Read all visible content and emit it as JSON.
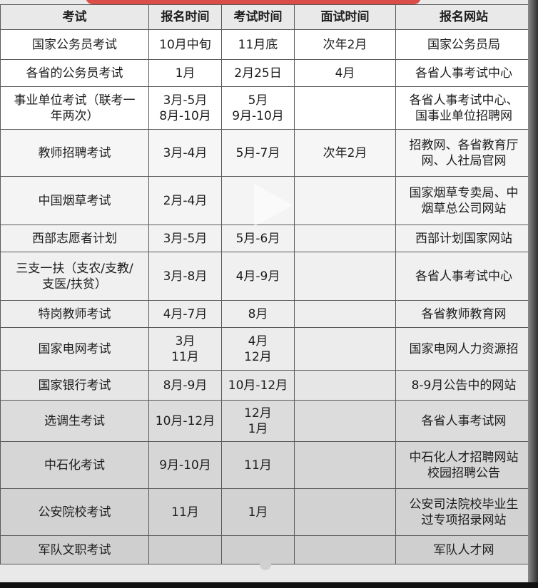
{
  "table": {
    "headers": [
      "考试",
      "报名时间",
      "考试时间",
      "面试时间",
      "报名网站"
    ],
    "rows": [
      {
        "name": [
          "国家公务员考试"
        ],
        "reg": [
          "10月中旬"
        ],
        "exam": [
          "11月底"
        ],
        "interview": [
          "次年2月"
        ],
        "site": [
          "国家公务员局"
        ]
      },
      {
        "name": [
          "各省的公务员考试"
        ],
        "reg": [
          "1月"
        ],
        "exam": [
          "2月25日"
        ],
        "interview": [
          "4月"
        ],
        "site": [
          "各省人事考试中心"
        ]
      },
      {
        "name": [
          "事业单位考试（联考一",
          "年两次）"
        ],
        "reg": [
          "3月-5月",
          "8月-10月"
        ],
        "exam": [
          "5月",
          "9月-10月"
        ],
        "interview": [],
        "site": [
          "各省人事考试中心、",
          "国事业单位招聘网"
        ]
      },
      {
        "name": [
          "教师招聘考试"
        ],
        "reg": [
          "3月-4月"
        ],
        "exam": [
          "5月-7月"
        ],
        "interview": [
          "次年2月"
        ],
        "site": [
          "招教网、各省教育厅",
          "网、人社局官网"
        ]
      },
      {
        "name": [
          "中国烟草考试"
        ],
        "reg": [
          "2月-4月"
        ],
        "exam": [],
        "interview": [],
        "site": [
          "国家烟草专卖局、中",
          "烟草总公司网站"
        ]
      },
      {
        "name": [
          "西部志愿者计划"
        ],
        "reg": [
          "3月-5月"
        ],
        "exam": [
          "5月-6月"
        ],
        "interview": [],
        "site": [
          "西部计划国家网站"
        ]
      },
      {
        "name": [
          "三支一扶（支农/支教/",
          "支医/扶贫）"
        ],
        "reg": [
          "3月-8月"
        ],
        "exam": [
          "4月-9月"
        ],
        "interview": [],
        "site": [
          "各省人事考试中心"
        ]
      },
      {
        "name": [
          "特岗教师考试"
        ],
        "reg": [
          "4月-7月"
        ],
        "exam": [
          "8月"
        ],
        "interview": [],
        "site": [
          "各省教师教育网"
        ]
      },
      {
        "name": [
          "国家电网考试"
        ],
        "reg": [
          "3月",
          "11月"
        ],
        "exam": [
          "4月",
          "12月"
        ],
        "interview": [],
        "site": [
          "国家电网人力资源招"
        ]
      },
      {
        "name": [
          "国家银行考试"
        ],
        "reg": [
          "8月-9月"
        ],
        "exam": [
          "10月-12月"
        ],
        "interview": [],
        "site": [
          "8-9月公告中的网站"
        ]
      },
      {
        "name": [
          "选调生考试"
        ],
        "reg": [
          "10月-12月"
        ],
        "exam": [
          "12月",
          "1月"
        ],
        "interview": [],
        "site": [
          "各省人事考试网"
        ]
      },
      {
        "name": [
          "中石化考试"
        ],
        "reg": [
          "9月-10月"
        ],
        "exam": [
          "11月"
        ],
        "interview": [],
        "site": [
          "中石化人才招聘网站",
          "校园招聘公告"
        ]
      },
      {
        "name": [
          "公安院校考试"
        ],
        "reg": [
          "11月"
        ],
        "exam": [
          "1月"
        ],
        "interview": [],
        "site": [
          "公安司法院校毕业生",
          "过专项招录网站"
        ]
      },
      {
        "name": [
          "军队文职考试"
        ],
        "reg": [],
        "exam": [],
        "interview": [],
        "site": [
          "军队人才网"
        ]
      }
    ]
  }
}
